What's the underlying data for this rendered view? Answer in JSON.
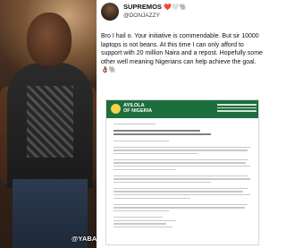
{
  "post": {
    "display_name": "SUPREMOS",
    "display_name_emoji": "❤️🤍🐘",
    "handle": "@DONJAZZY",
    "text": "Bro I hail o. Your initiative is commendable. But sir 10000 laptops is not beans. At this time I can only afford to support with 20 million Naira and a repost. Hopefully some other well meaning Nigerians can help achieve the goal. 👌🏾🐘"
  },
  "letter": {
    "org_name_line1": "AYILOLA",
    "org_name_line2": "OF NIGERIA"
  },
  "photo": {
    "watermark": "@YABALEFTONLINE"
  },
  "colors": {
    "letterhead_green": "#1c6e3d",
    "text": "#111111"
  }
}
